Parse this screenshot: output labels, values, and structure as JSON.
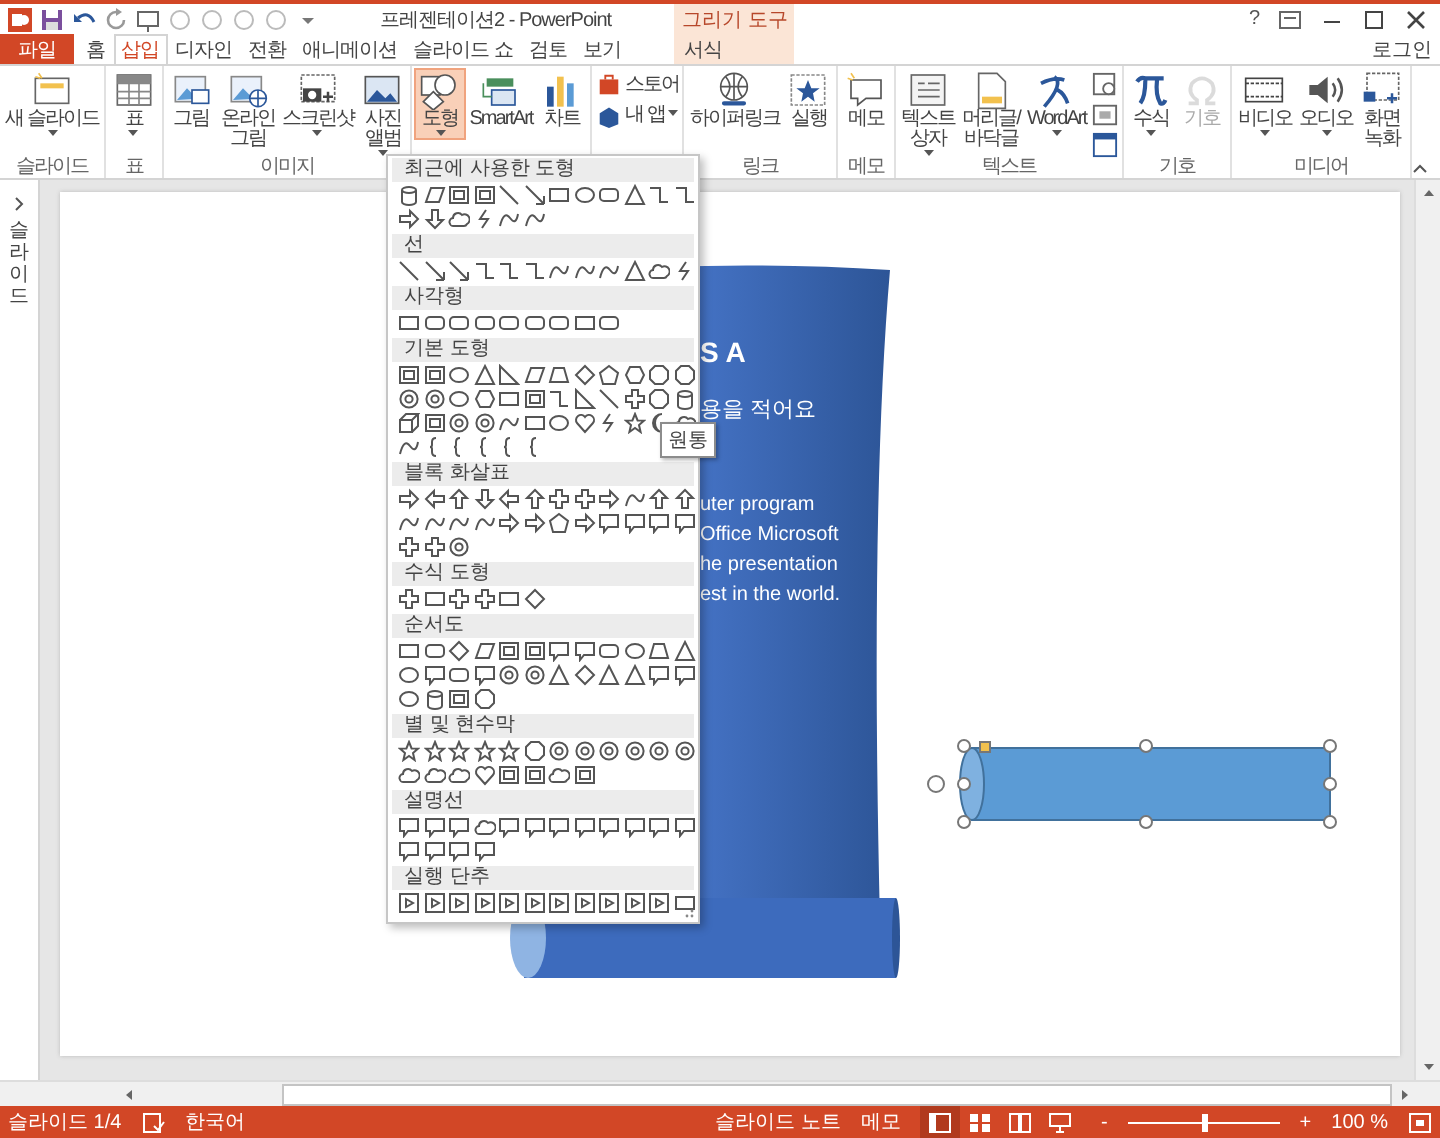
{
  "title_bar": {
    "title": "프레젠테이션2 - PowerPoint",
    "context_group": "그리기 도구",
    "help": "?"
  },
  "tabs": [
    {
      "label": "파일",
      "kind": "file",
      "selected": false
    },
    {
      "label": "홈",
      "kind": "normal",
      "selected": false
    },
    {
      "label": "삽입",
      "kind": "normal",
      "selected": true
    },
    {
      "label": "디자인",
      "kind": "normal",
      "selected": false
    },
    {
      "label": "전환",
      "kind": "normal",
      "selected": false
    },
    {
      "label": "애니메이션",
      "kind": "normal",
      "selected": false
    },
    {
      "label": "슬라이드 쇼",
      "kind": "normal",
      "selected": false
    },
    {
      "label": "검토",
      "kind": "normal",
      "selected": false
    },
    {
      "label": "보기",
      "kind": "normal",
      "selected": false
    },
    {
      "label": "서식",
      "kind": "context",
      "selected": false
    }
  ],
  "sign_in": "로그인",
  "ribbon": {
    "groups": [
      {
        "label": "슬라이드",
        "buttons": [
          {
            "kind": "large",
            "lines": [
              "새 슬라이드"
            ],
            "dropdown": true,
            "selected": false,
            "disabled": false
          }
        ]
      },
      {
        "label": "표",
        "buttons": [
          {
            "kind": "large",
            "lines": [
              "표"
            ],
            "dropdown": true,
            "selected": false,
            "disabled": false
          }
        ]
      },
      {
        "label": "이미지",
        "buttons": [
          {
            "kind": "large",
            "lines": [
              "그림"
            ],
            "dropdown": false,
            "selected": false,
            "disabled": false
          },
          {
            "kind": "large",
            "lines": [
              "온라인",
              "그림"
            ],
            "dropdown": false,
            "selected": false,
            "disabled": false
          },
          {
            "kind": "large",
            "lines": [
              "스크린샷"
            ],
            "dropdown": true,
            "selected": false,
            "disabled": false
          },
          {
            "kind": "large",
            "lines": [
              "사진",
              "앨범"
            ],
            "dropdown": true,
            "selected": false,
            "disabled": false
          }
        ]
      },
      {
        "buttons": [
          {
            "kind": "large",
            "lines": [
              "도형"
            ],
            "dropdown": true,
            "selected": true,
            "disabled": false
          },
          {
            "kind": "large",
            "lines": [
              "SmartArt"
            ],
            "dropdown": false,
            "selected": false,
            "disabled": false
          },
          {
            "kind": "large",
            "lines": [
              "차트"
            ],
            "dropdown": false,
            "selected": false,
            "disabled": false
          }
        ]
      },
      {
        "buttons": [
          {
            "kind": "small",
            "lines": [
              "스토어"
            ],
            "dropdown": false,
            "selected": false,
            "disabled": false
          },
          {
            "kind": "small",
            "lines": [
              "내 앱"
            ],
            "dropdown": true,
            "selected": false,
            "disabled": false
          }
        ]
      },
      {
        "label": "링크",
        "buttons": [
          {
            "kind": "large",
            "lines": [
              "하이퍼링크"
            ],
            "dropdown": false,
            "selected": false,
            "disabled": false
          },
          {
            "kind": "large",
            "lines": [
              "실행"
            ],
            "dropdown": false,
            "selected": false,
            "disabled": false
          }
        ]
      },
      {
        "label": "메모",
        "buttons": [
          {
            "kind": "large",
            "lines": [
              "메모"
            ],
            "dropdown": false,
            "selected": false,
            "disabled": false
          }
        ]
      },
      {
        "label": "텍스트",
        "buttons": [
          {
            "kind": "large",
            "lines": [
              "텍스트",
              "상자"
            ],
            "dropdown": true,
            "selected": false,
            "disabled": false
          },
          {
            "kind": "large",
            "lines": [
              "머리글/",
              "바닥글"
            ],
            "dropdown": false,
            "selected": false,
            "disabled": false
          },
          {
            "kind": "large",
            "lines": [
              "WordArt"
            ],
            "dropdown": true,
            "selected": false,
            "disabled": false
          },
          {
            "kind": "small",
            "dropdown": false,
            "selected": false,
            "disabled": false
          },
          {
            "kind": "small",
            "dropdown": false,
            "selected": false,
            "disabled": false
          },
          {
            "kind": "small",
            "dropdown": false,
            "selected": false,
            "disabled": false
          }
        ]
      },
      {
        "label": "기호",
        "buttons": [
          {
            "kind": "large",
            "lines": [
              "수식"
            ],
            "dropdown": true,
            "selected": false,
            "disabled": false
          },
          {
            "kind": "large",
            "lines": [
              "기호"
            ],
            "dropdown": false,
            "selected": false,
            "disabled": true
          }
        ]
      },
      {
        "label": "미디어",
        "buttons": [
          {
            "kind": "large",
            "lines": [
              "비디오"
            ],
            "dropdown": true,
            "selected": false,
            "disabled": false
          },
          {
            "kind": "large",
            "lines": [
              "오디오"
            ],
            "dropdown": true,
            "selected": false,
            "disabled": false
          },
          {
            "kind": "large",
            "lines": [
              "화면",
              "녹화"
            ],
            "dropdown": false,
            "selected": false,
            "disabled": false
          }
        ]
      }
    ]
  },
  "shapes_gallery": {
    "sections": [
      {
        "title": "최근에 사용한 도형"
      },
      {
        "title": "선"
      },
      {
        "title": "사각형"
      },
      {
        "title": "기본 도형"
      },
      {
        "title": "블록 화살표"
      },
      {
        "title": "수식 도형"
      },
      {
        "title": "순서도"
      },
      {
        "title": "별 및 현수막"
      },
      {
        "title": "설명선"
      },
      {
        "title": "실행 단추"
      }
    ],
    "tooltip": "원통"
  },
  "thumbnail_pane": {
    "label": "슬라이드"
  },
  "slide": {
    "title": "S A",
    "subtitle": "용을 적어요",
    "body": [
      "uter program",
      "Office Microsoft",
      "he presentation",
      "est in the world."
    ]
  },
  "status_bar": {
    "slide_info": "슬라이드 1/4",
    "language": "한국어",
    "notes": "슬라이드 노트",
    "comments": "메모",
    "views": [
      {
        "selected": true
      },
      {
        "selected": false
      },
      {
        "selected": false
      },
      {
        "selected": false
      }
    ],
    "zoom_minus": "-",
    "zoom_plus": "+",
    "zoom": {
      "level": 0.5
    },
    "zoom_reading": "100 %"
  }
}
